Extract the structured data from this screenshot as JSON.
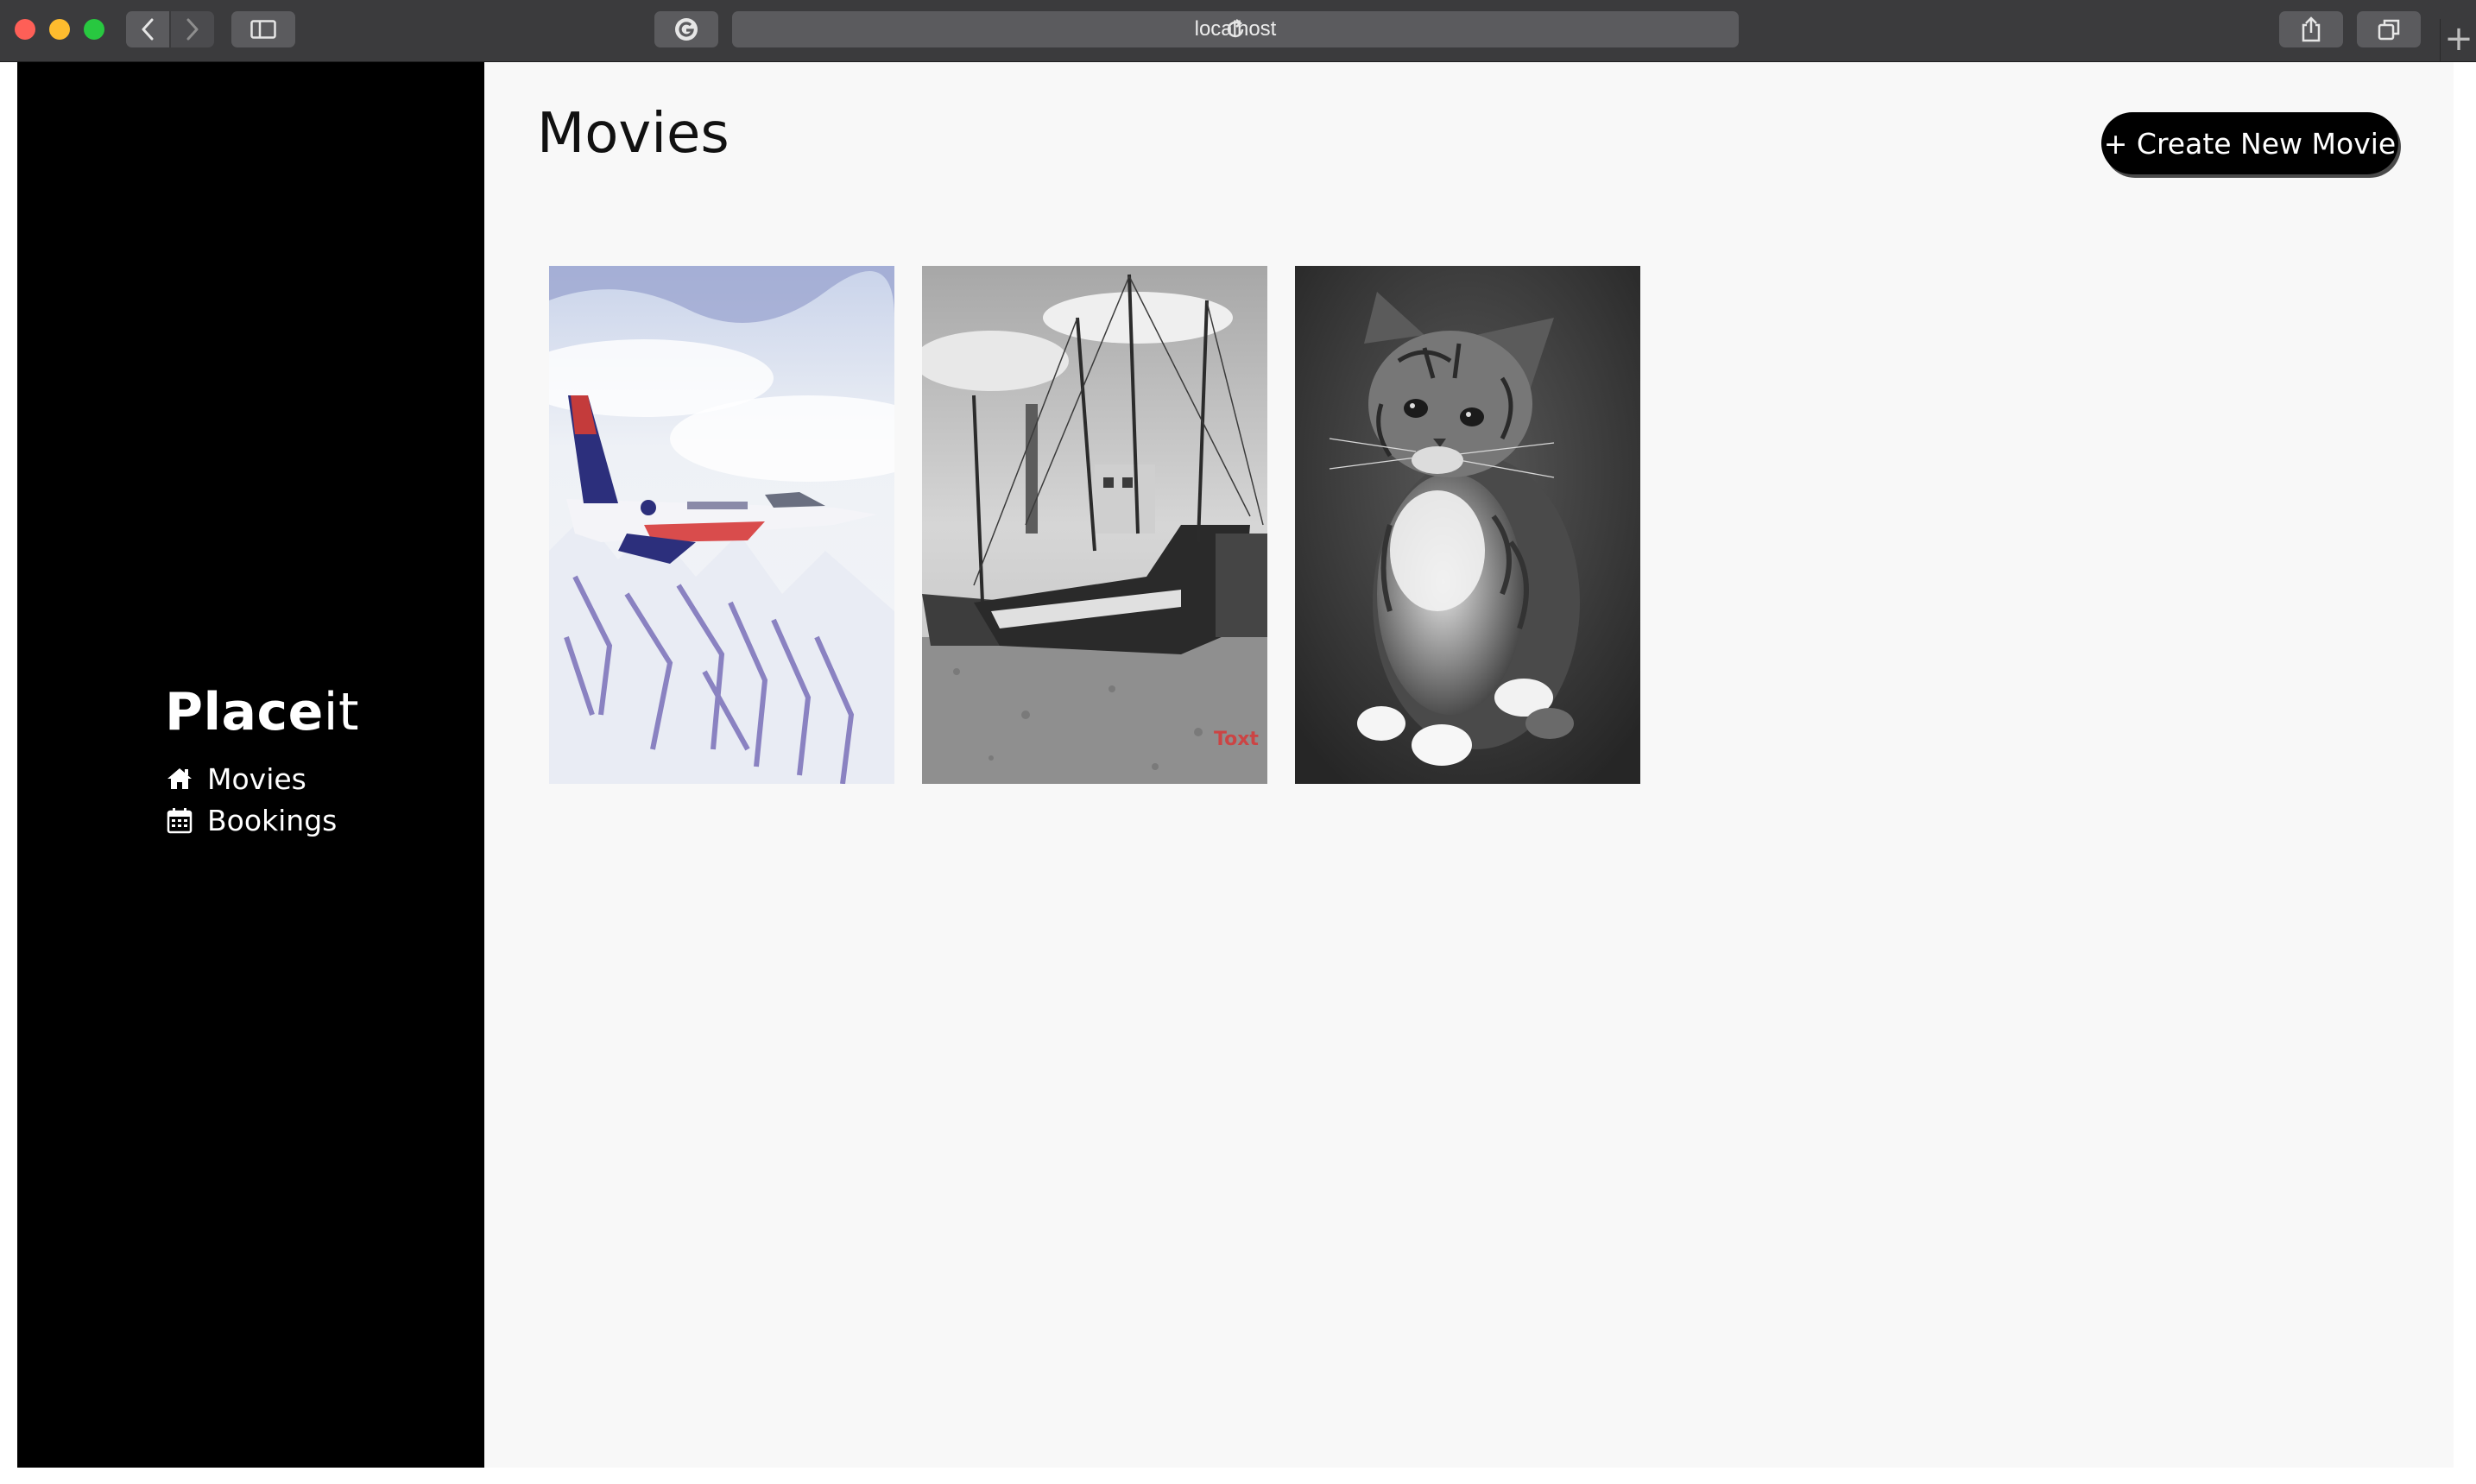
{
  "browser": {
    "url": "localhost",
    "new_tab_glyph": "+",
    "icons": [
      "back-icon",
      "forward-icon",
      "sidebar-icon",
      "extension-icon",
      "reload-icon",
      "share-icon",
      "tabs-icon"
    ]
  },
  "sidebar": {
    "brand_bold": "Place",
    "brand_thin": "it",
    "items": [
      {
        "label": "Movies",
        "icon": "home-icon"
      },
      {
        "label": "Bookings",
        "icon": "calendar-icon"
      }
    ]
  },
  "main": {
    "title": "Movies",
    "create_button": "+ Create New Movie",
    "movies": [
      {
        "poster": "fighter-jet-over-mountains"
      },
      {
        "poster": "fishing-boats-in-harbor"
      },
      {
        "poster": "kitten-black-and-white"
      }
    ]
  },
  "colors": {
    "sidebar_bg": "#000000",
    "main_bg": "#f8f8f8",
    "button_bg": "#000000",
    "button_text": "#ffffff",
    "chrome_bg": "#3b3b3d"
  }
}
